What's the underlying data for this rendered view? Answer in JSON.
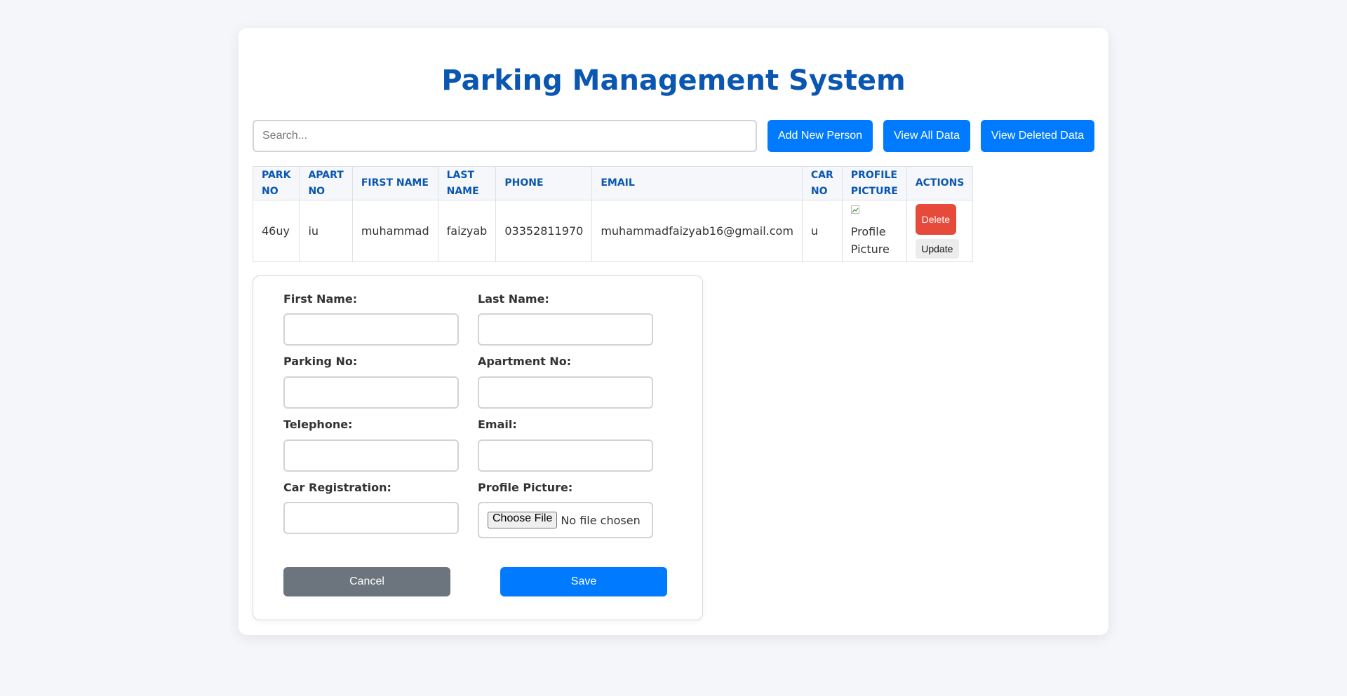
{
  "page": {
    "title": "Parking Management System"
  },
  "toolbar": {
    "search_placeholder": "Search...",
    "add_label": "Add New Person",
    "view_all_label": "View All Data",
    "view_deleted_label": "View Deleted Data"
  },
  "table": {
    "headers": [
      [
        "PARK",
        "NO"
      ],
      [
        "APART",
        "NO"
      ],
      [
        "FIRST NAME"
      ],
      [
        "LAST",
        "NAME"
      ],
      [
        "PHONE"
      ],
      [
        "EMAIL"
      ],
      [
        "CAR",
        "NO"
      ],
      [
        "PROFILE",
        "PICTURE"
      ],
      [
        "ACTIONS"
      ]
    ],
    "rows": [
      {
        "park_no": "46uy",
        "apart_no": "iu",
        "first_name": "muhammad",
        "last_name": "faizyab",
        "phone": "03352811970",
        "email": "muhammadfaizyab16@gmail.com",
        "car_no": "u",
        "profile_alt": [
          "Profile",
          "Picture"
        ],
        "delete_label": "Delete",
        "update_label": "Update"
      }
    ]
  },
  "form": {
    "first_name_label": "First Name:",
    "last_name_label": "Last Name:",
    "parking_no_label": "Parking No:",
    "apartment_no_label": "Apartment No:",
    "telephone_label": "Telephone:",
    "email_label": "Email:",
    "car_registration_label": "Car Registration:",
    "profile_picture_label": "Profile Picture:",
    "choose_file_label": "Choose File",
    "no_file_text": "No file chosen",
    "cancel_label": "Cancel",
    "save_label": "Save"
  },
  "colors": {
    "accent": "#007bff",
    "title": "#0a56b0",
    "danger": "#e64a3b",
    "secondary": "#6c757d"
  }
}
